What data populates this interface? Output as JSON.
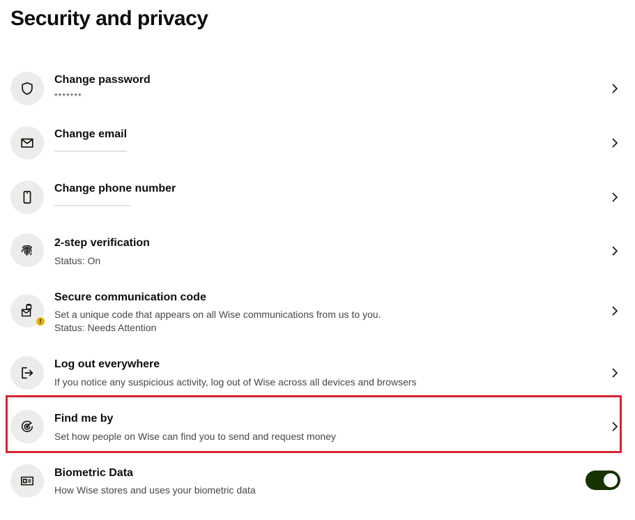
{
  "page": {
    "title": "Security and privacy"
  },
  "items": [
    {
      "title": "Change password",
      "subtitle": "*******",
      "icon": "shield-icon"
    },
    {
      "title": "Change email",
      "subtitle": "",
      "icon": "mail-icon"
    },
    {
      "title": "Change phone number",
      "subtitle": "",
      "icon": "phone-icon"
    },
    {
      "title": "2-step verification",
      "subtitle": "Status: On",
      "icon": "fingerprint-icon"
    },
    {
      "title": "Secure communication code",
      "subtitle": "Set a unique code that appears on all Wise communications from us to you.",
      "subtitle2": "Status: Needs Attention",
      "icon": "secure-message-icon",
      "badge": "!"
    },
    {
      "title": "Log out everywhere",
      "subtitle": "If you notice any suspicious activity, log out of Wise across all devices and browsers",
      "icon": "logout-icon"
    },
    {
      "title": "Find me by",
      "subtitle": "Set how people on Wise can find you to send and request money",
      "icon": "target-icon"
    },
    {
      "title": "Biometric Data",
      "subtitle": "How Wise stores and uses your biometric data",
      "icon": "id-card-icon",
      "toggle_on": true
    }
  ],
  "colors": {
    "highlight": "#d9232e",
    "toggle": "#163300",
    "badge": "#e3b300",
    "icon_bg": "#ecedea"
  }
}
